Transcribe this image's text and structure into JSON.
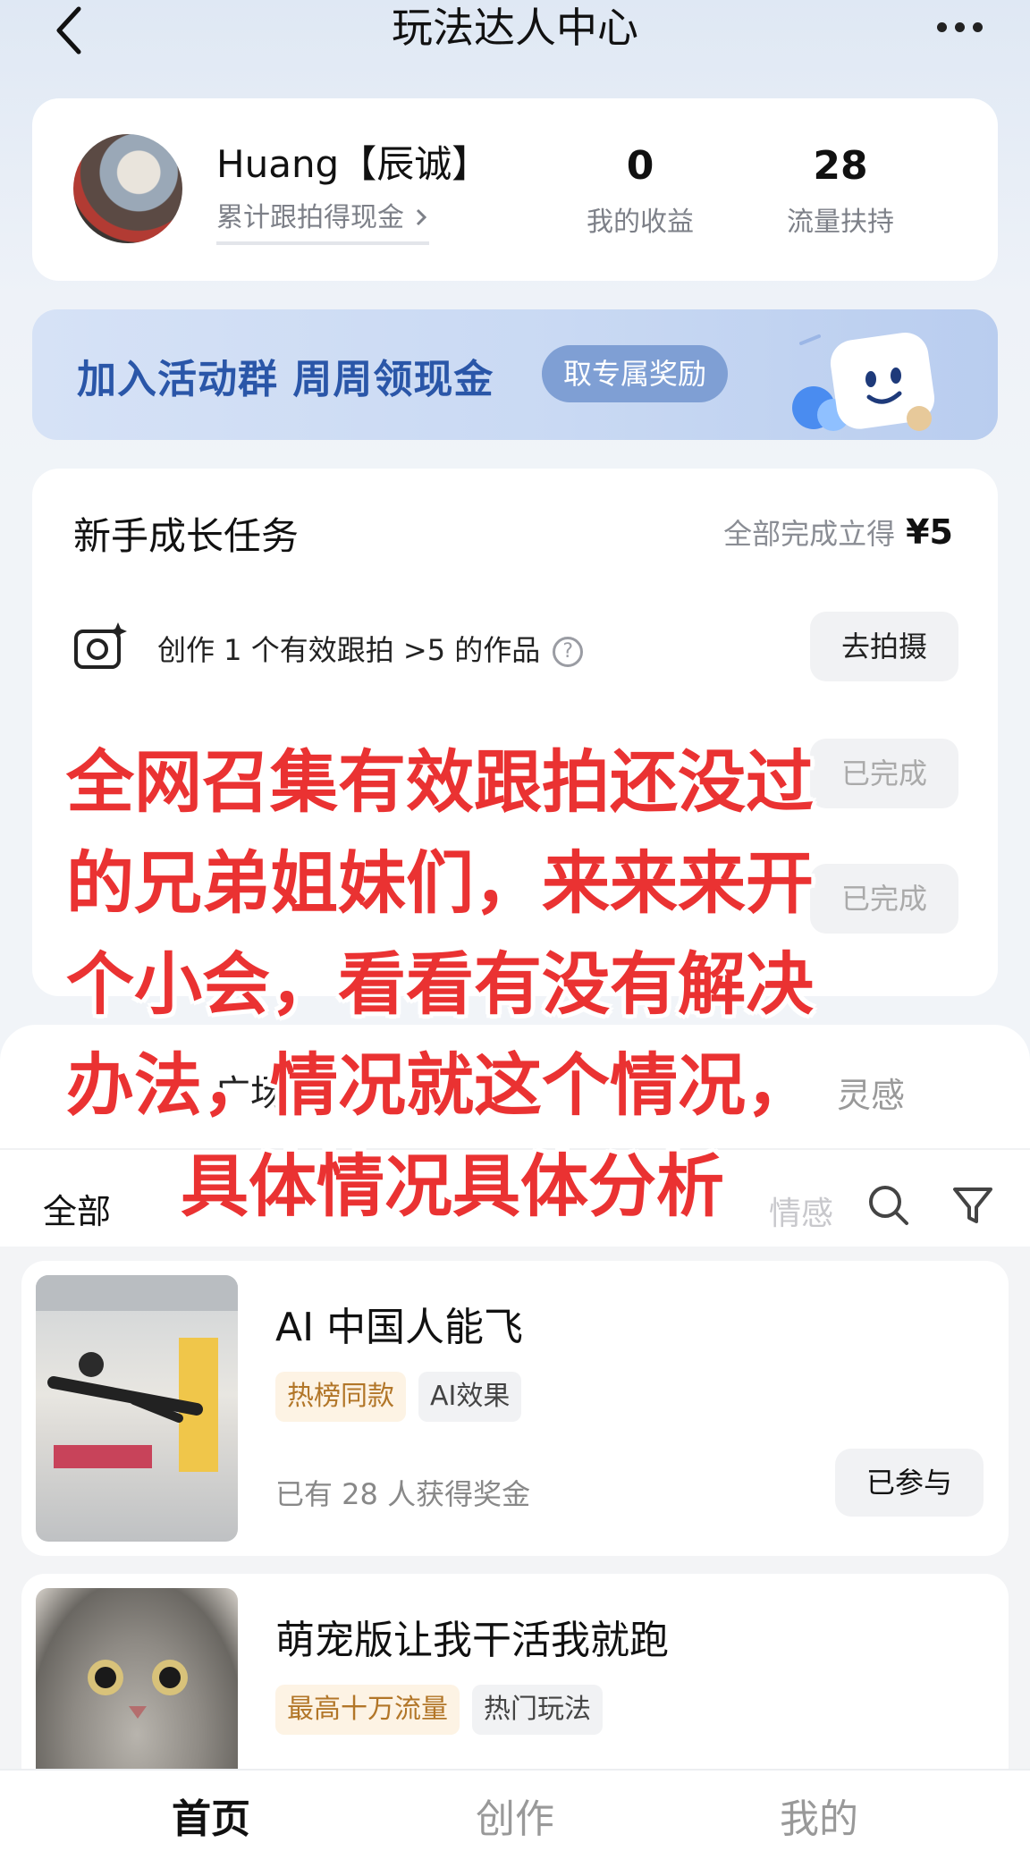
{
  "header": {
    "title": "玩法达人中心"
  },
  "profile": {
    "name": "Huang【辰诚】",
    "earn_link": "累计跟拍得现金",
    "stats": [
      {
        "value": "0",
        "label": "我的收益"
      },
      {
        "value": "28",
        "label": "流量扶持"
      }
    ]
  },
  "banner": {
    "text": "加入活动群 周周领现金",
    "button": "取专属奖励"
  },
  "tasks": {
    "title": "新手成长任务",
    "reward_prefix": "全部完成立得",
    "reward_amount": "¥5",
    "rows": [
      {
        "text": "创作 1 个有效跟拍 >5 的作品",
        "help": "?",
        "button": "去拍摄"
      },
      {
        "text": "",
        "button": "已完成"
      },
      {
        "text": "",
        "button": "已完成"
      }
    ]
  },
  "plaza": {
    "title_fragment": "广场",
    "side_fragment": "灵感",
    "tab_all": "全部",
    "tab_hint": "情感"
  },
  "items": [
    {
      "title": "AI 中国人能飞",
      "tags": [
        "热榜同款",
        "AI效果"
      ],
      "meta": "已有 28 人获得奖金",
      "button": "已参与"
    },
    {
      "title": "萌宠版让我干活我就跑",
      "tags": [
        "最高十万流量",
        "热门玩法"
      ]
    }
  ],
  "overlay": {
    "lines": [
      "全网召集有效跟拍还没过",
      "的兄弟姐妹们，来来来开",
      "个小会，看看有没有解决",
      "办法，情况就这个情况，",
      "具体情况具体分析"
    ]
  },
  "tabbar": {
    "tabs": [
      "首页",
      "创作",
      "我的"
    ],
    "active": "首页"
  },
  "colors": {
    "overlay_red": "#ea3232",
    "accent_blue": "#2a56a8",
    "tag_hot": "#b27628"
  }
}
